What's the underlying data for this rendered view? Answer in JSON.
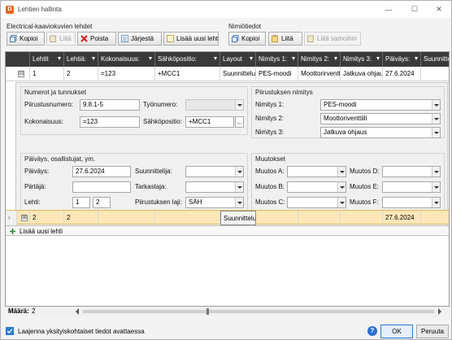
{
  "window": {
    "title": "Lehtien hallinta",
    "app_icon": "D",
    "minimize": "—",
    "maximize": "☐",
    "close": "✕"
  },
  "toolbar_left": {
    "label": "Electrical-kaaviokuvien lehdet",
    "buttons": [
      {
        "label": "Kopioi",
        "enabled": true,
        "icon": "copy-icon"
      },
      {
        "label": "Liitä",
        "enabled": false,
        "icon": "paste-icon"
      },
      {
        "label": "Poista",
        "enabled": true,
        "icon": "delete-icon"
      },
      {
        "label": "Järjestä",
        "enabled": true,
        "icon": "sort-icon"
      },
      {
        "label": "Lisää uusi lehti",
        "enabled": true,
        "icon": "add-sheet-icon"
      }
    ]
  },
  "toolbar_right": {
    "label": "Nimiötiedot",
    "buttons": [
      {
        "label": "Kopioi",
        "enabled": true,
        "icon": "copy-icon"
      },
      {
        "label": "Liitä",
        "enabled": true,
        "icon": "paste-icon"
      },
      {
        "label": "Liitä samoihin",
        "enabled": false,
        "icon": "paste-same-icon"
      }
    ]
  },
  "grid": {
    "columns": [
      "Lehtit",
      "Lehtiä:",
      "Kokonaisuus:",
      "Sähköpositio:",
      "Layout",
      "Nimitys 1:",
      "Nimitys 2:",
      "Nimitys 3:",
      "Päiväys:",
      "Suunnittelija"
    ],
    "rows": [
      {
        "expand": "⊟",
        "cells": [
          "1",
          "2",
          "=123",
          "+MCC1",
          "Suunnittelu",
          "PES-moodi",
          "Moottorirventt",
          "Jatkuva ohjau",
          "27.6.2024",
          ""
        ]
      },
      {
        "expand": "⊞",
        "cells": [
          "2",
          "2",
          "",
          "",
          "Suunnittelu",
          "",
          "",
          "",
          "27.6.2024",
          ""
        ]
      }
    ],
    "add_row_label": "Lisää uusi lehti",
    "row_indicator": "›"
  },
  "detail": {
    "numbers": {
      "title": "Numerot ja tunnukset",
      "piirustusnumero_label": "Piirustusnumero:",
      "piirustusnumero": "9.8.1-5",
      "tyonumero_label": "Työnumero:",
      "tyonumero": "",
      "kokonaisuus_label": "Kokonaisuus:",
      "kokonaisuus": "=123",
      "sahkopositio_label": "Sähköpositio:",
      "sahkopositio": "+MCC1",
      "ellipsis": "..."
    },
    "naming": {
      "title": "Piirustuksen nimitys",
      "n1_label": "Nimitys 1:",
      "n1": "PES-moodi",
      "n2_label": "Nimitys 2:",
      "n2": "Moottoriventtiili",
      "n3_label": "Nimitys 3:",
      "n3": "Jatkuva ohjaus"
    },
    "dates": {
      "title": "Päiväys, osallistujat, ym.",
      "paivays_label": "Päiväys:",
      "paivays": "27.6.2024",
      "piirtaja_label": "Piirtäjä:",
      "piirtaja": "",
      "lehti_label": "Lehti:",
      "lehti_a": "1",
      "lehti_b": "2",
      "suunnittelija_label": "Suunnittelija:",
      "suunnittelija": "",
      "tarkastaja_label": "Tarkastaja:",
      "tarkastaja": "",
      "laji_label": "Piirustuksen laji:",
      "laji": "SÄH"
    },
    "changes": {
      "title": "Muutokset",
      "a_label": "Muutos A:",
      "b_label": "Muutos B:",
      "c_label": "Muutos C:",
      "d_label": "Muutos D:",
      "e_label": "Muutos E:",
      "f_label": "Muutos F:"
    }
  },
  "footer": {
    "count_label": "Määrä:",
    "count": "2",
    "checkbox_label": "Laajenna yksityiskohtaiset tiedot avattaessa",
    "checkbox_checked": true,
    "ok": "OK",
    "cancel": "Peruuta",
    "help": "?"
  },
  "colors": {
    "header": "#3a3a3a",
    "selected_row": "#fde7b8",
    "accent": "#2a7bd6"
  }
}
